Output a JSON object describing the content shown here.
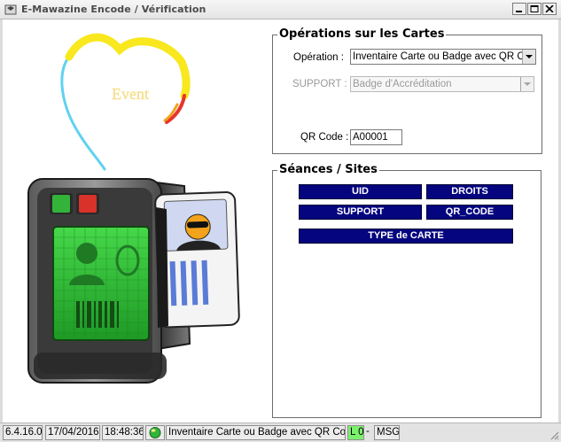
{
  "window": {
    "title": "E-Mawazine Encode / Vérification"
  },
  "operations": {
    "title": "Opérations sur les Cartes",
    "operation_label": "Opération :",
    "operation_value": "Inventaire Carte ou Badge avec QR Code",
    "support_label": "SUPPORT :",
    "support_value": "Badge d'Accréditation",
    "qr_label": "QR Code :",
    "qr_value": "A00001"
  },
  "seances": {
    "title": "Séances / Sites",
    "buttons": [
      "UID",
      "DROITS",
      "SUPPORT",
      "QR_CODE",
      "TYPE de CARTE"
    ]
  },
  "logo": {
    "text": "Event",
    "colors": [
      "#f8e81d",
      "#5fd2f0",
      "#e8342b",
      "#f2a21b"
    ]
  },
  "statusbar": {
    "version": "6.4.16.0",
    "date": "17/04/2016",
    "time": "18:48:36",
    "operation": "Inventaire Carte ou Badge avec QR Code",
    "level": "L 0",
    "separator": "-",
    "msg": "MSG"
  },
  "colors": {
    "button_bg": "#05057f",
    "status_green": "#7cf06e",
    "screen_green": "#36c93a"
  }
}
